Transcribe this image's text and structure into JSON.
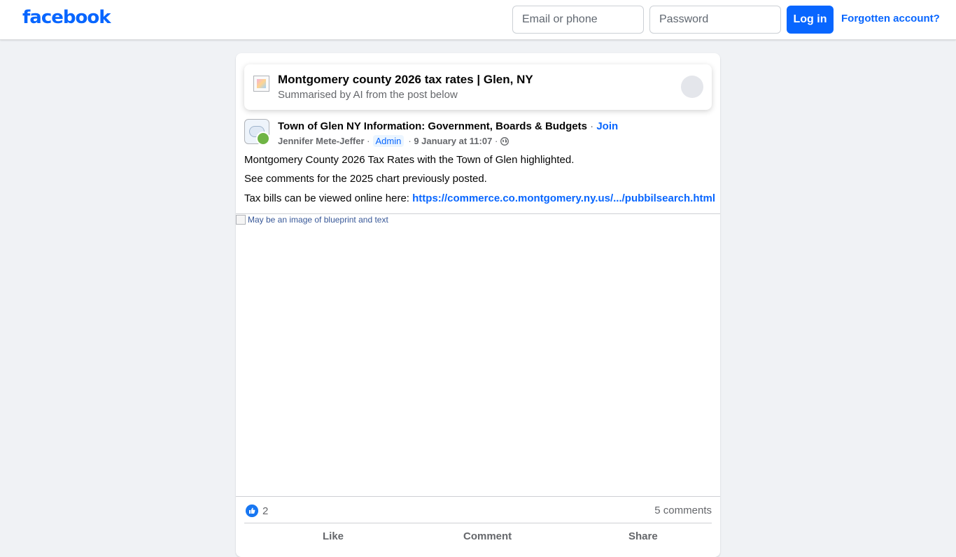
{
  "header": {
    "logo": "facebook",
    "email_placeholder": "Email or phone",
    "password_placeholder": "Password",
    "login_label": "Log in",
    "forgot_label": "Forgotten account?"
  },
  "summary": {
    "title": "Montgomery county 2026 tax rates | Glen, NY",
    "subtitle": "Summarised by AI from the post below"
  },
  "post": {
    "group_name": "Town of Glen NY Information: Government, Boards & Budgets",
    "join_label": "Join",
    "author": "Jennifer Mete-Jeffer",
    "badge": "Admin",
    "date": "9 January at 11:07",
    "line1": "Montgomery County 2026 Tax Rates with the Town of Glen highlighted.",
    "line2": "See comments for the 2025 chart previously posted.",
    "line3_prefix": "Tax bills can be viewed online here: ",
    "link": "https://commerce.co.montgomery.ny.us/.../pubbilsearch.html",
    "image_alt": "May be an image of blueprint and text"
  },
  "engagement": {
    "likes": "2",
    "comments": "5 comments",
    "like_label": "Like",
    "comment_label": "Comment",
    "share_label": "Share"
  },
  "colors": {
    "brand": "#0866ff",
    "background": "#f0f2f5",
    "secondary_text": "#65676b"
  },
  "icons": [
    "globe-icon",
    "like-icon",
    "broken-image-icon"
  ]
}
